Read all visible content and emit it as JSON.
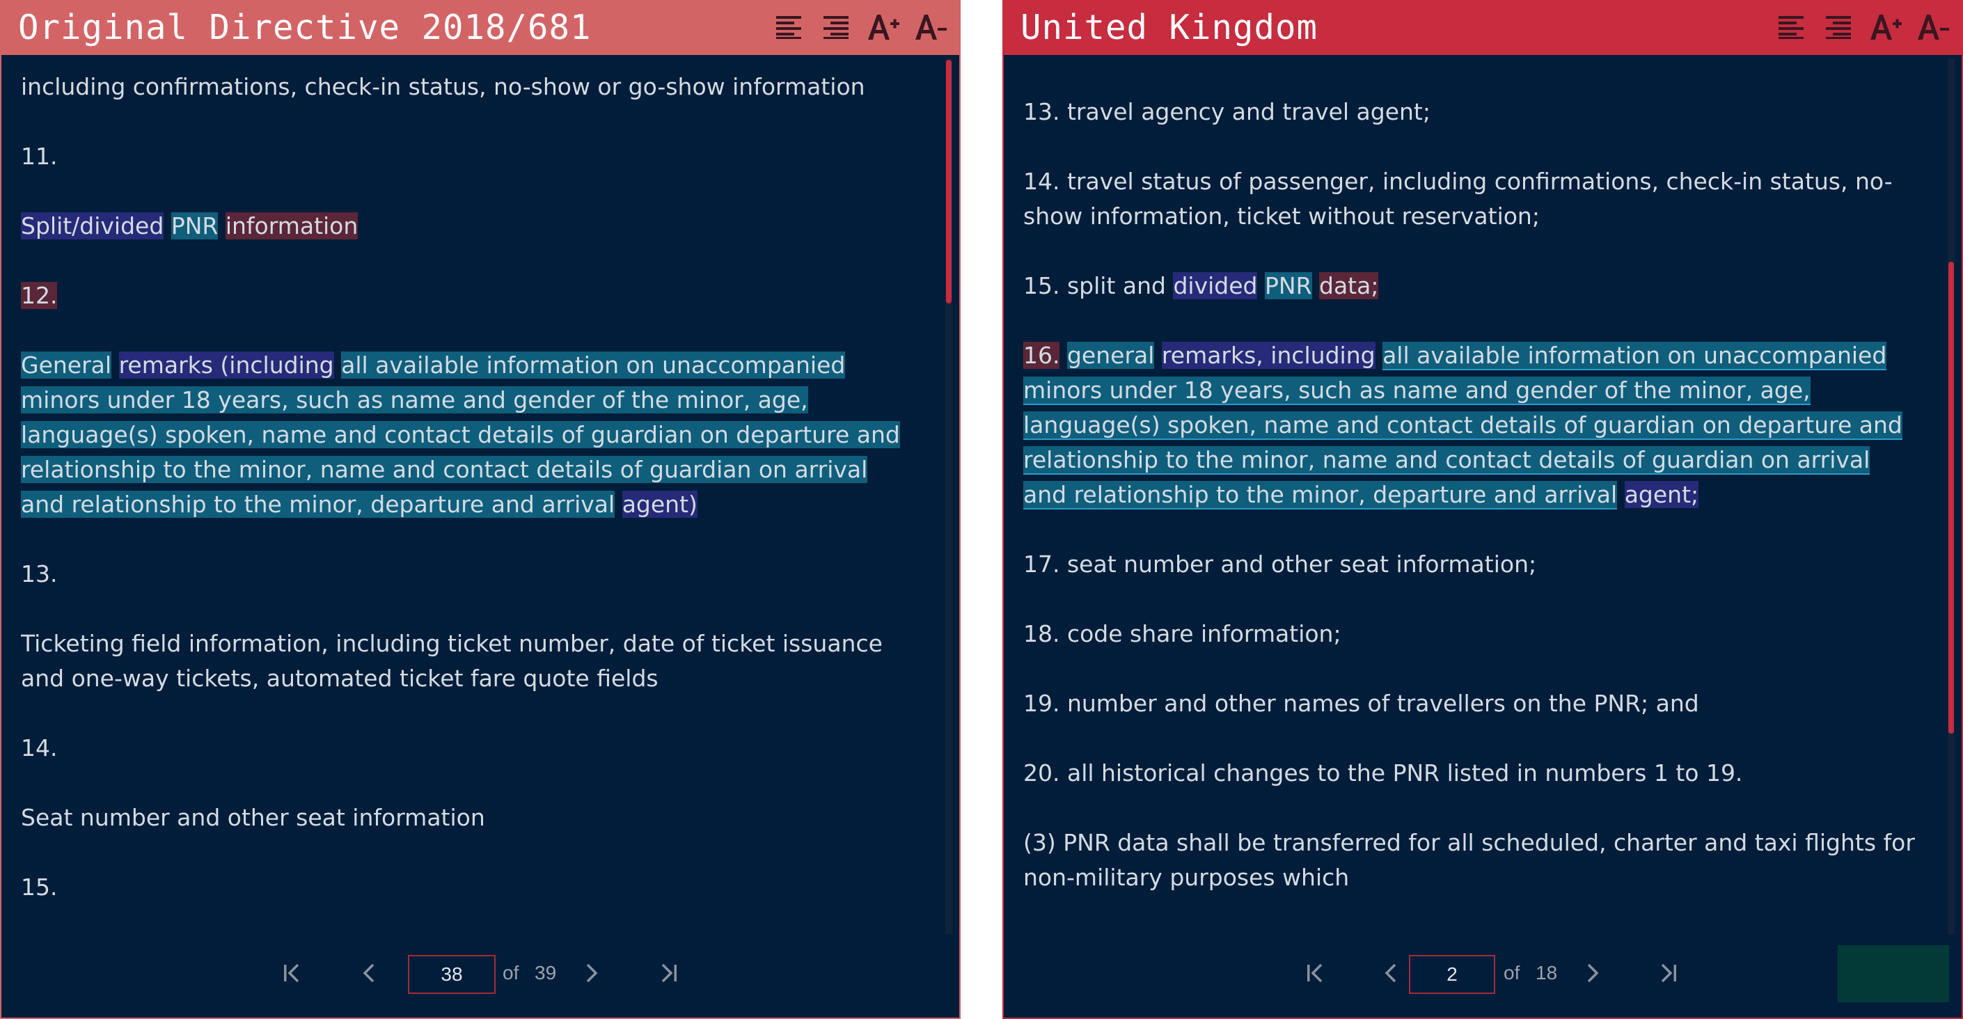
{
  "left_panel": {
    "title": "Original Directive 2018/681",
    "tools": [
      "align-left-icon",
      "align-right-icon",
      "font-increase-icon",
      "font-decrease-icon"
    ],
    "paragraphs": {
      "p0": "including confirmations, check-in status, no-show or go-show information",
      "p1": "11.",
      "p2_a": "Split/divided",
      "p2_b": "PNR",
      "p2_c": "information",
      "p3": "12.",
      "p4_a": "General",
      "p4_b": "remarks (including",
      "p4_c": "all available information on unaccompanied minors under 18 years, such as name and gender of the minor, age, language(s) spoken, name and contact details of guardian on departure and relationship to the minor, name and contact details of guardian on arrival and relationship to the minor, departure and arrival",
      "p4_d": "agent)",
      "p5": "13.",
      "p6": "Ticketing field information, including ticket number, date of ticket issuance and one-way tickets, automated ticket fare quote fields",
      "p7": "14.",
      "p8": "Seat number and other seat information",
      "p9": "15."
    },
    "pager": {
      "current": "38",
      "of_label": "of",
      "total": "39"
    }
  },
  "right_panel": {
    "title": "United Kingdom",
    "tools": [
      "align-left-icon",
      "align-right-icon",
      "font-increase-icon",
      "font-decrease-icon"
    ],
    "paragraphs": {
      "p0": "13. travel agency and travel agent;",
      "p1": "14. travel status of passenger, including confirmations, check-in status, no-show information, ticket without reservation;",
      "p2_a": "15. split and",
      "p2_b": "divided",
      "p2_c": "PNR",
      "p2_d": "data;",
      "p3_a": "16.",
      "p3_b": "general",
      "p3_c": "remarks, including",
      "p3_d": "all available information on unaccompanied minors under 18 years, such as name and gender of the minor, age, language(s) spoken, name and contact details of guardian on departure and relationship to the minor, name and contact details of guardian on arrival and relationship to the minor, departure and arrival",
      "p3_e": "agent;",
      "p4": "17. seat number and other seat information;",
      "p5": "18. code share information;",
      "p6": "19. number and other names of travellers on the PNR; and",
      "p7": "20. all historical changes to the PNR listed in numbers 1 to 19.",
      "p8": "(3) PNR data shall be transferred for all scheduled, charter and taxi flights for non-military purposes which"
    },
    "pager": {
      "current": "2",
      "of_label": "of",
      "total": "18"
    }
  },
  "colors": {
    "background": "#011d39",
    "left_header": "#d36466",
    "right_header": "#c72c3f",
    "highlight_cyan": "#0f5e7c",
    "highlight_purple": "#262a78",
    "highlight_red": "#5a2638"
  }
}
